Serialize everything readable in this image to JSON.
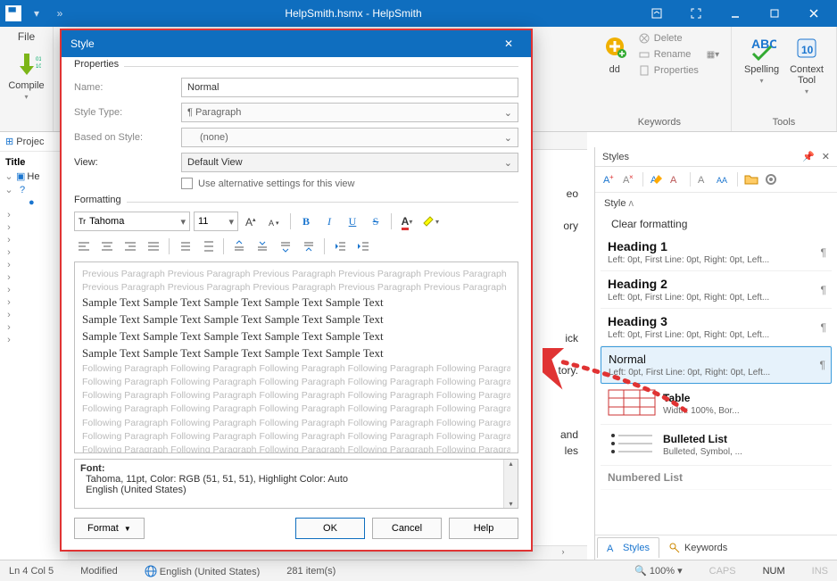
{
  "titleBar": {
    "title": "HelpSmith.hsmx - HelpSmith"
  },
  "ribbon": {
    "file": "File",
    "compile": "Compile",
    "add": "dd",
    "delete": "Delete",
    "rename": "Rename",
    "properties": "Properties",
    "keywordsGroup": "Keywords",
    "spelling": "Spelling",
    "contextTool": "Context\nTool",
    "toolsGroup": "Tools"
  },
  "leftPanel": {
    "header": "Projec",
    "title": "Title",
    "root": "He"
  },
  "stylesPanel": {
    "header": "Styles",
    "section": "Style",
    "clear": "Clear formatting",
    "items": [
      {
        "name": "Heading 1",
        "desc": "Left: 0pt, First Line: 0pt, Right: 0pt, Left..."
      },
      {
        "name": "Heading 2",
        "desc": "Left: 0pt, First Line: 0pt, Right: 0pt, Left..."
      },
      {
        "name": "Heading 3",
        "desc": "Left: 0pt, First Line: 0pt, Right: 0pt, Left..."
      },
      {
        "name": "Normal",
        "desc": "Left: 0pt, First Line: 0pt, Right: 0pt, Left..."
      },
      {
        "name": "Table",
        "desc": "Width: 100%, Bor..."
      },
      {
        "name": "Bulleted List",
        "desc": "Bulleted, Symbol, ..."
      },
      {
        "name": "Numbered List",
        "desc": ""
      }
    ],
    "tabs": {
      "styles": "Styles",
      "keywords": "Keywords"
    }
  },
  "statusBar": {
    "pos": "Ln 4 Col 5",
    "modified": "Modified",
    "lang": "English (United States)",
    "items": "281 item(s)",
    "zoom": "100%",
    "caps": "CAPS",
    "num": "NUM",
    "ins": "INS"
  },
  "dialog": {
    "title": "Style",
    "propsLabel": "Properties",
    "name": "Name:",
    "nameVal": "Normal",
    "styleType": "Style Type:",
    "styleTypeVal": "¶ Paragraph",
    "basedOn": "Based on Style:",
    "basedOnVal": "(none)",
    "view": "View:",
    "viewVal": "Default View",
    "altCheck": "Use alternative settings for this view",
    "formattingLabel": "Formatting",
    "font": "Tahoma",
    "size": "11",
    "previewPrev": "Previous Paragraph Previous Paragraph Previous Paragraph Previous Paragraph Previous Paragraph",
    "previewSample": "Sample Text Sample Text Sample Text Sample Text Sample Text",
    "previewNext": "Following Paragraph Following Paragraph Following Paragraph Following Paragraph Following Paragraph",
    "fontSummaryTitle": "Font:",
    "fontSummaryLine": "Tahoma, 11pt, Color: RGB (51, 51, 51), Highlight Color: Auto",
    "fontSummaryLang": "English (United States)",
    "format": "Format",
    "ok": "OK",
    "cancel": "Cancel",
    "help": "Help"
  },
  "editorFragments": {
    "eo": "eo",
    "ory": "ory",
    "ick": "ick",
    "tory": "tory.",
    "and": "and",
    "les": "les"
  }
}
